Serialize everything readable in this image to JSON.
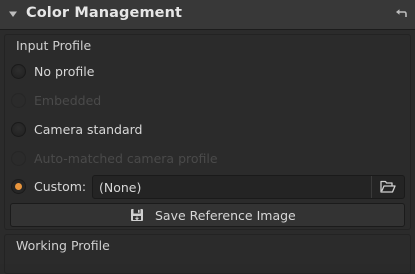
{
  "header": {
    "title": "Color Management",
    "collapse_icon": "chevron-down-icon",
    "reset_icon": "reset-arrow-icon"
  },
  "input_profile": {
    "label": "Input Profile",
    "options": [
      {
        "label": "No profile",
        "checked": false,
        "enabled": true
      },
      {
        "label": "Embedded",
        "checked": false,
        "enabled": false
      },
      {
        "label": "Camera standard",
        "checked": false,
        "enabled": true
      },
      {
        "label": "Auto-matched camera profile",
        "checked": false,
        "enabled": false
      },
      {
        "label": "Custom:",
        "checked": true,
        "enabled": true
      }
    ],
    "custom_value": "(None)",
    "browse_icon": "folder-open-icon",
    "save_button_label": "Save Reference Image",
    "save_icon": "save-icon"
  },
  "working_profile": {
    "label": "Working Profile"
  },
  "colors": {
    "accent": "#e8953d",
    "background": "#2b2b2b",
    "header": "#383838"
  }
}
